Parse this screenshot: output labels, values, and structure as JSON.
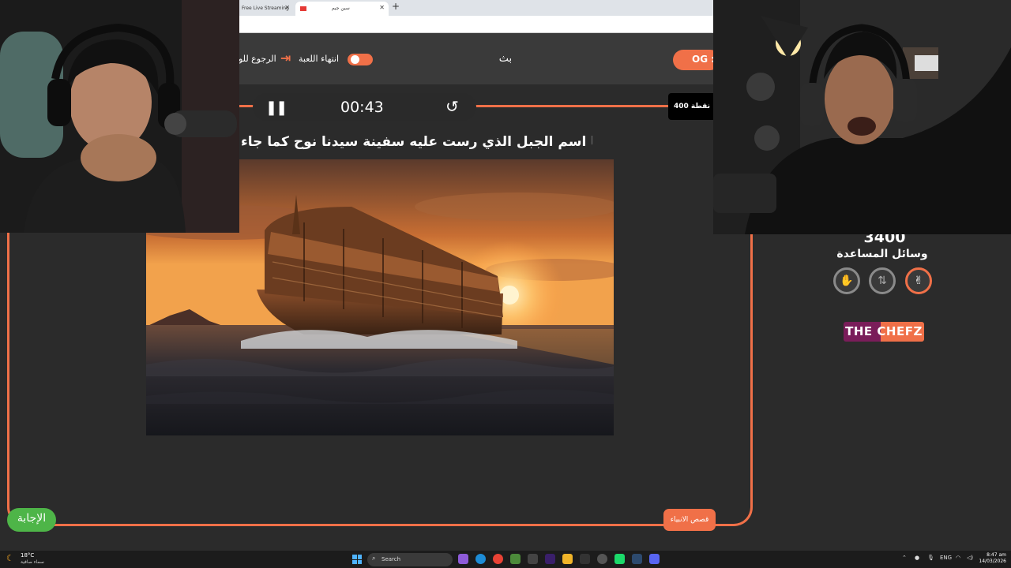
{
  "browser": {
    "tab1_title": "Free Live Streaming",
    "tab2_title": "سين جيم",
    "new_tab": "+"
  },
  "header": {
    "team_label": "OG :",
    "streamer_name": "بث",
    "end_game": "انتهاء اللعبة",
    "back": "الرجوع للو"
  },
  "timer": {
    "time": "00:43",
    "points": "400 نقطة"
  },
  "question": {
    "text": "ما اسم الجبل الذي رست عليه سفينة سيدنا نوح كما جاء"
  },
  "category": "قصص الانبياء",
  "answer_button": "الإجابة",
  "side_panel": {
    "score": "3400",
    "help_title": "وسائل المساعدة",
    "lifelines": [
      "hand-icon",
      "swap-icon",
      "two-fingers-icon"
    ],
    "sponsor_a": "THE",
    "sponsor_b": "CHEFZ"
  },
  "taskbar": {
    "temperature": "18°C",
    "weather": "سماء صافية",
    "search_placeholder": "Search",
    "language": "ENG",
    "time": "8:47 am",
    "date": "14/03/2026"
  },
  "colors": {
    "accent": "#f07048",
    "answer": "#4eb548",
    "background": "#2b2b2b"
  }
}
